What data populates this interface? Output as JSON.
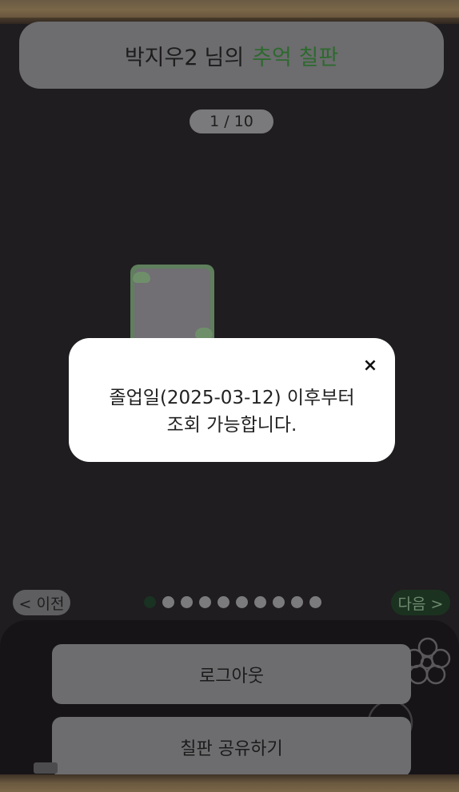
{
  "header": {
    "name": "박지우2",
    "title_mid": "님의",
    "title_highlight": "추억 칠판"
  },
  "counter": "1 / 10",
  "nav": {
    "prev_label": "< 이전",
    "next_label": "다음 >",
    "page_count": 10,
    "current_page": 1
  },
  "modal": {
    "close_icon": "×",
    "line1": "졸업일(2025-03-12) 이후부터",
    "line2": "조회 가능합니다."
  },
  "bottom": {
    "logout_label": "로그아웃",
    "share_label": "칠판 공유하기"
  },
  "colors": {
    "board": "#1f1d20",
    "accent_green": "#2d6a2f",
    "modal_bg": "#ffffff"
  }
}
